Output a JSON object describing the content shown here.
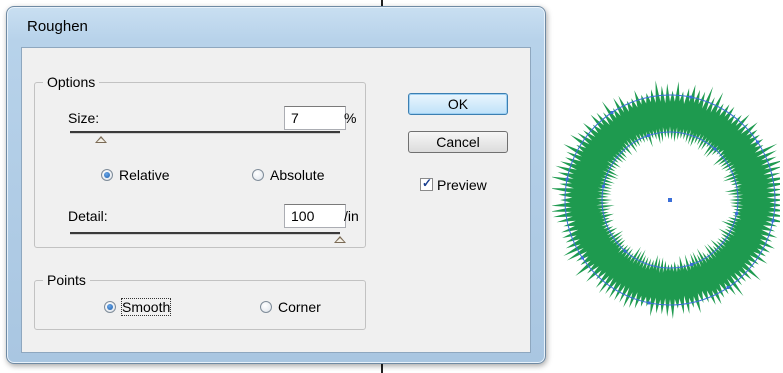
{
  "dialog": {
    "title": "Roughen",
    "ok_label": "OK",
    "cancel_label": "Cancel",
    "preview_label": "Preview",
    "preview_checked": true
  },
  "options": {
    "legend": "Options",
    "size_label": "Size:",
    "size_value": "7",
    "size_unit": "%",
    "size_slider_percent": 7,
    "relative_label": "Relative",
    "absolute_label": "Absolute",
    "relative_selected": true,
    "detail_label": "Detail:",
    "detail_value": "100",
    "detail_unit": "/in",
    "detail_slider_percent": 100
  },
  "points": {
    "legend": "Points",
    "smooth_label": "Smooth",
    "corner_label": "Corner",
    "smooth_selected": true
  },
  "colors": {
    "roughen_fill": "#1e9a4f",
    "anchor_path": "#3b6fd8"
  },
  "icons": {
    "size_thumb": "triangle-slider-thumb-icon",
    "detail_thumb": "triangle-slider-thumb-icon"
  }
}
